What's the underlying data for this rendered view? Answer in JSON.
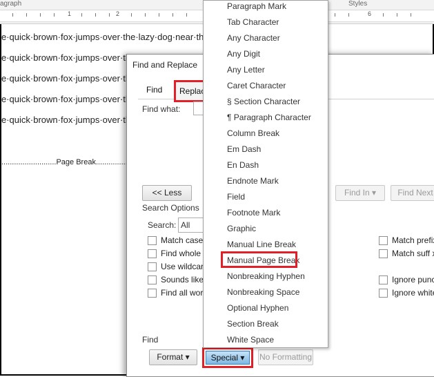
{
  "ruler": {
    "group_left": "agraph",
    "group_right": "Styles",
    "numbers": [
      "1",
      "2",
      "6"
    ]
  },
  "document": {
    "lines": [
      "e·quick·brown·fox·jumps·over·the·lazy·dog·near·the",
      "e·quick·brown·fox·jumps·over·th",
      "e·quick·brown·fox·jumps·over·th",
      "e·quick·brown·fox·jumps·over·th",
      "e·quick·brown·fox·jumps·over·th"
    ],
    "page_break": "..........................Page Break..............................¶"
  },
  "dialog": {
    "title": "Find and Replace",
    "tabs": {
      "find": "Find",
      "replace": "Replace"
    },
    "find_what_label": "Find what:",
    "less_button": "<< Less",
    "find_in_button": "Find In ▾",
    "find_next_button": "Find Next",
    "search_options_label": "Search Options",
    "search_label": "Search:",
    "search_value": "All",
    "options_left": [
      "Match case",
      "Find whole v",
      "Use wildcard",
      "Sounds like (",
      "Find all word"
    ],
    "options_right": [
      "Match prefix",
      "Match suff x",
      "Ignore punc",
      "Ignore white"
    ],
    "find_section_label": "Find",
    "format_button": "Format ▾",
    "special_button": "Special ▾",
    "no_formatting_button": "No Formatting"
  },
  "special_menu": {
    "items": [
      "Paragraph Mark",
      "Tab Character",
      "Any Character",
      "Any Digit",
      "Any Letter",
      "Caret Character",
      "§ Section Character",
      "¶ Paragraph Character",
      "Column Break",
      "Em Dash",
      "En Dash",
      "Endnote Mark",
      "Field",
      "Footnote Mark",
      "Graphic",
      "Manual Line Break",
      "Manual Page Break",
      "Nonbreaking Hyphen",
      "Nonbreaking Space",
      "Optional Hyphen",
      "Section Break",
      "White Space"
    ],
    "highlighted": "Manual Page Break"
  },
  "colors": {
    "highlight_border": "#e01f26",
    "special_button_fill": "#7fb7e2"
  }
}
